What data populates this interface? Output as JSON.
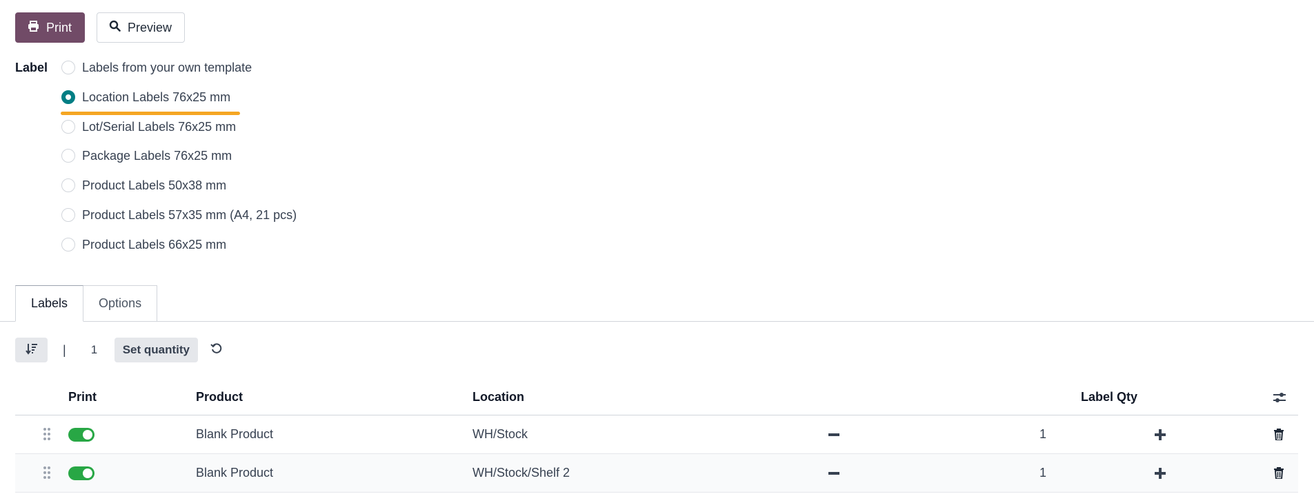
{
  "toolbar": {
    "print_label": "Print",
    "preview_label": "Preview"
  },
  "label_field": {
    "title": "Label",
    "options": [
      {
        "label": "Labels from your own template",
        "checked": false
      },
      {
        "label": "Location Labels 76x25 mm",
        "checked": true
      },
      {
        "label": "Lot/Serial Labels 76x25 mm",
        "checked": false
      },
      {
        "label": "Package Labels 76x25 mm",
        "checked": false
      },
      {
        "label": "Product Labels 50x38 mm",
        "checked": false
      },
      {
        "label": "Product Labels 57x35 mm (A4, 21 pcs)",
        "checked": false
      },
      {
        "label": "Product Labels 66x25 mm",
        "checked": false
      }
    ]
  },
  "tabs": [
    {
      "label": "Labels",
      "active": true
    },
    {
      "label": "Options",
      "active": false
    }
  ],
  "controls": {
    "separator": "|",
    "quantity": "1",
    "set_quantity_label": "Set quantity"
  },
  "table": {
    "headers": {
      "print": "Print",
      "product": "Product",
      "location": "Location",
      "label_qty": "Label Qty"
    },
    "rows": [
      {
        "print": true,
        "product": "Blank Product",
        "location": "WH/Stock",
        "qty": "1"
      },
      {
        "print": true,
        "product": "Blank Product",
        "location": "WH/Stock/Shelf 2",
        "qty": "1"
      }
    ]
  },
  "colors": {
    "primary": "#714b67",
    "radio_checked": "#017e84",
    "highlight": "#f5a623",
    "toggle_on": "#28a745"
  },
  "icons": [
    "print-icon",
    "search-icon",
    "sort-icon",
    "reset-icon",
    "column-settings-icon",
    "drag-handle-icon",
    "minus-icon",
    "plus-icon",
    "trash-icon"
  ]
}
